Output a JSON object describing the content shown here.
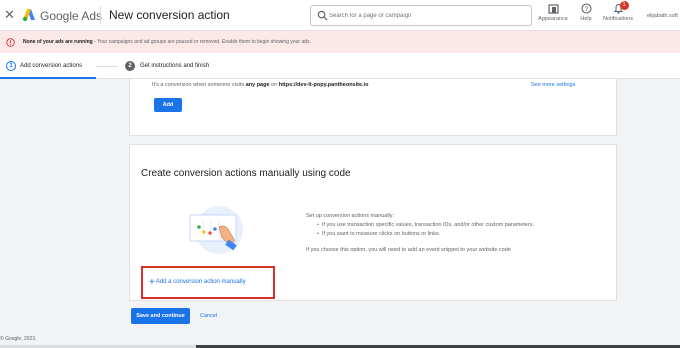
{
  "topbar": {
    "close_icon": "close-icon",
    "brand_first": "Google",
    "brand_second": "Ads",
    "page_title": "New conversion action",
    "search_placeholder": "Search for a page or campaign",
    "appearance_label": "Appearance",
    "help_label": "Help",
    "notifications_label": "Notifications",
    "notifications_count": "1",
    "account": "elijabath.soft"
  },
  "alert": {
    "bold_text": "None of your ads are running",
    "rest_text": " - Your campaigns and ad groups are paused or removed. Enable them to begin showing your ads."
  },
  "stepper": {
    "steps": [
      {
        "number": "1",
        "label": "Add conversion actions"
      },
      {
        "number": "2",
        "label": "Get instructions and finish"
      }
    ]
  },
  "website_card": {
    "desc_prefix": "It's a conversion when someone visits ",
    "desc_bold": "any page",
    "desc_mid": " on ",
    "desc_url": "https://dev-lt-popy.pantheonsite.io",
    "see_more": "See more settings",
    "add_button": "Add"
  },
  "manual_card": {
    "title": "Create conversion actions manually using code",
    "intro": "Set up conversion actions manually:",
    "bullets": [
      "If you use transaction specific values, transaction IDs, and/or other custom parameters.",
      "If you want to measure clicks on buttons or links."
    ],
    "note": "If you choose this option, you will need to add an event snippet to your website code",
    "add_manual_link": "Add a conversion action manually"
  },
  "actions": {
    "save_button": "Save and continue",
    "cancel_link": "Cancel"
  },
  "footer": {
    "copyright": "© Google, 2023."
  },
  "colors": {
    "primary": "#1a73e8",
    "alert_bg": "#fce8e6",
    "highlight_border": "#d93025"
  }
}
